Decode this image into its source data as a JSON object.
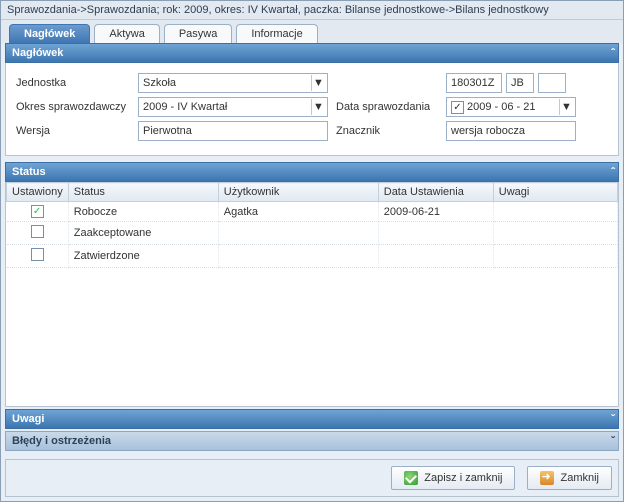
{
  "titlebar": "Sprawozdania->Sprawozdania; rok: 2009, okres: IV Kwartał, paczka: Bilanse jednostkowe->Bilans jednostkowy",
  "tabs": {
    "naglowek": "Nagłówek",
    "aktywa": "Aktywa",
    "pasywa": "Pasywa",
    "informacje": "Informacje"
  },
  "section_naglowek": "Nagłówek",
  "form": {
    "jednostka_label": "Jednostka",
    "jednostka_value": "Szkoła",
    "jednostka_code": "180301Z",
    "jednostka_short": "JB",
    "okres_label": "Okres sprawozdawczy",
    "okres_value": "2009 - IV Kwartał",
    "data_label": "Data sprawozdania",
    "data_value": "2009 - 06 - 21",
    "wersja_label": "Wersja",
    "wersja_value": "Pierwotna",
    "znacznik_label": "Znacznik",
    "znacznik_value": "wersja robocza"
  },
  "section_status": "Status",
  "grid": {
    "headers": {
      "ustawiony": "Ustawiony",
      "status": "Status",
      "uzytkownik": "Użytkownik",
      "data": "Data Ustawienia",
      "uwagi": "Uwagi"
    },
    "rows": [
      {
        "set": true,
        "status": "Robocze",
        "user": "Agatka",
        "date": "2009-06-21",
        "uwagi": ""
      },
      {
        "set": false,
        "status": "Zaakceptowane",
        "user": "",
        "date": "",
        "uwagi": ""
      },
      {
        "set": false,
        "status": "Zatwierdzone",
        "user": "",
        "date": "",
        "uwagi": ""
      }
    ]
  },
  "section_uwagi": "Uwagi",
  "section_bledy": "Błędy i ostrzeżenia",
  "buttons": {
    "save_close": "Zapisz i zamknij",
    "close": "Zamknij"
  }
}
